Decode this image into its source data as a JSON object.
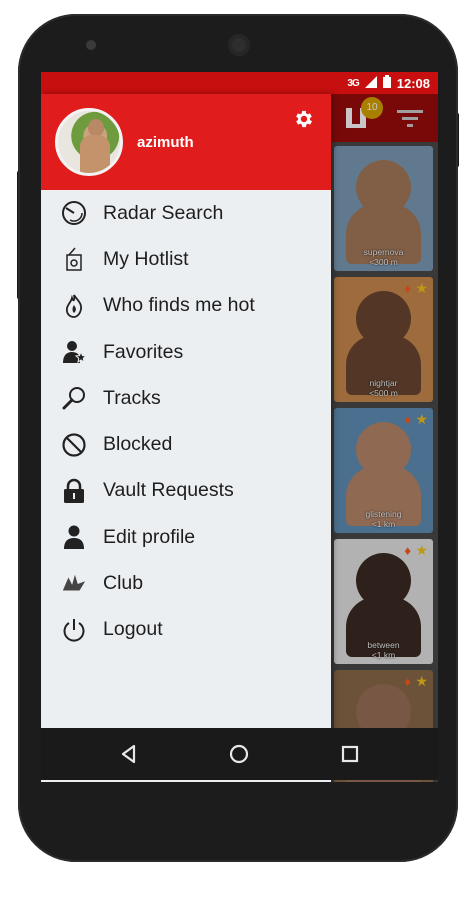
{
  "status": {
    "signal": "3G",
    "time": "12:08"
  },
  "app": {
    "badge_count": "10"
  },
  "drawer": {
    "username": "azimuth",
    "menu": [
      {
        "label": "Radar Search",
        "icon": "radar-icon"
      },
      {
        "label": "My Hotlist",
        "icon": "hotlist-icon"
      },
      {
        "label": "Who finds me hot",
        "icon": "flame-icon"
      },
      {
        "label": "Favorites",
        "icon": "favorites-icon"
      },
      {
        "label": "Tracks",
        "icon": "tracks-icon"
      },
      {
        "label": "Blocked",
        "icon": "blocked-icon"
      },
      {
        "label": "Vault Requests",
        "icon": "lock-icon"
      },
      {
        "label": "Edit profile",
        "icon": "user-icon"
      },
      {
        "label": "Club",
        "icon": "club-icon"
      },
      {
        "label": "Logout",
        "icon": "power-icon"
      }
    ]
  },
  "grid": {
    "tiles": [
      {
        "name": "supernova",
        "distance": "<300 m",
        "bg": "#7c9bb8",
        "skin": "#a57a5a"
      },
      {
        "name": "nightjar",
        "distance": "<500 m",
        "bg": "#c98a4e",
        "skin": "#6b4631"
      },
      {
        "name": "glistening",
        "distance": "<1 km",
        "bg": "#5f8fb8",
        "skin": "#b9876a"
      },
      {
        "name": "between",
        "distance": "<1 km",
        "bg": "#e4e4e4",
        "skin": "#3c2a22"
      },
      {
        "name": "",
        "distance": "",
        "bg": "#8a6a4a",
        "skin": "#9a7058"
      }
    ]
  },
  "colors": {
    "accent": "#e01c1c",
    "statusbar": "#c80f0f",
    "drawer_bg": "#eceff2"
  }
}
